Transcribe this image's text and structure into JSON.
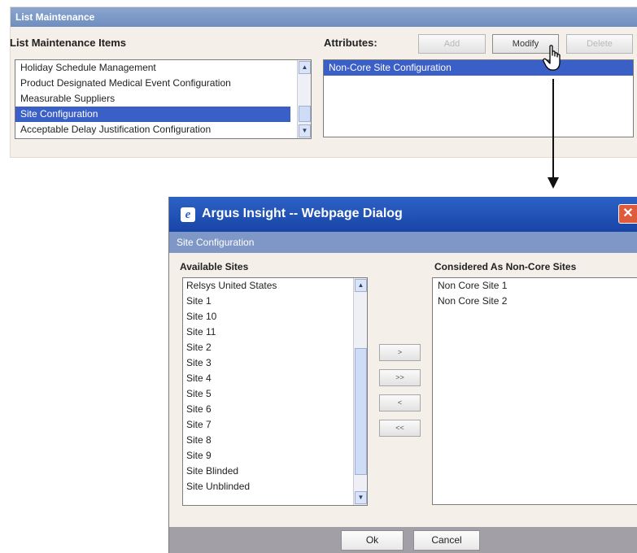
{
  "list_maintenance": {
    "header": "List Maintenance",
    "items_label": "List Maintenance Items",
    "items": [
      "Holiday Schedule Management",
      "Product Designated Medical Event Configuration",
      "Measurable Suppliers",
      "Site Configuration",
      "Acceptable Delay Justification Configuration"
    ],
    "selected_item": "Site Configuration",
    "attributes_label": "Attributes:",
    "attributes": [
      "Non-Core Site Configuration"
    ],
    "buttons": {
      "add": "Add",
      "modify": "Modify",
      "delete": "Delete"
    }
  },
  "dialog": {
    "title": "Argus Insight -- Webpage Dialog",
    "close_glyph": "✕",
    "subheader": "Site Configuration",
    "available_label": "Available Sites",
    "available_sites": [
      "Relsys United States",
      "Site 1",
      "Site 10",
      "Site 11",
      "Site 2",
      "Site 3",
      "Site 4",
      "Site 5",
      "Site 6",
      "Site 7",
      "Site 8",
      "Site 9",
      "Site Blinded",
      "Site Unblinded"
    ],
    "noncore_label": "Considered As Non-Core Sites",
    "noncore_sites": [
      "Non Core Site 1",
      "Non Core Site 2"
    ],
    "move_buttons": {
      "move_one_right": ">",
      "move_all_right": ">>",
      "move_one_left": "<",
      "move_all_left": "<<"
    },
    "ok_label": "Ok",
    "cancel_label": "Cancel"
  },
  "icons": {
    "ie_icon": "e",
    "scroll_up": "▲",
    "scroll_down": "▼",
    "cursor": "hand-pointer"
  }
}
